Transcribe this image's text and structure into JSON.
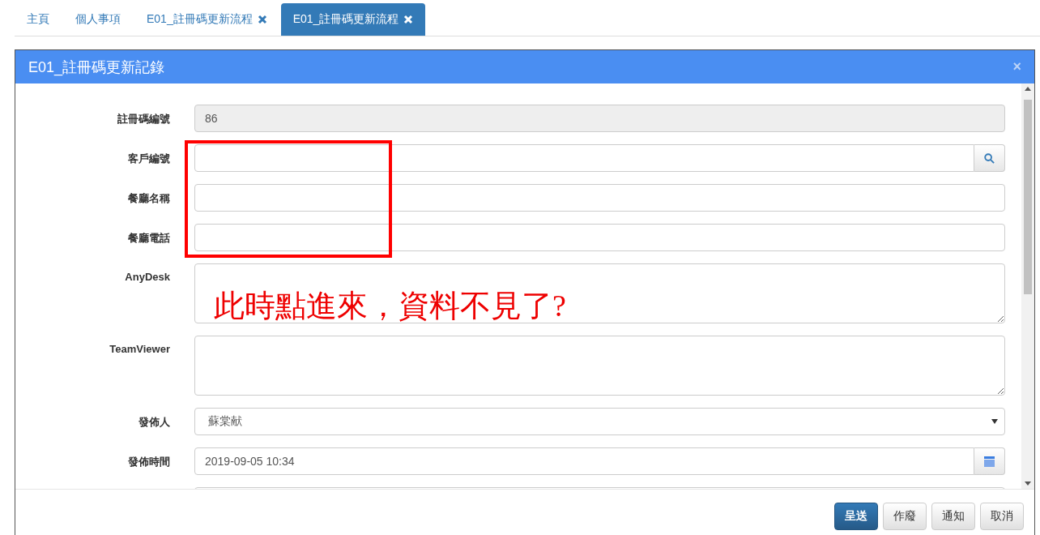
{
  "tabs": [
    {
      "label": "主頁",
      "closable": false,
      "selected": false
    },
    {
      "label": "個人事項",
      "closable": false,
      "selected": false
    },
    {
      "label": "E01_註冊碼更新流程",
      "closable": true,
      "selected": false
    },
    {
      "label": "E01_註冊碼更新流程",
      "closable": true,
      "selected": true
    }
  ],
  "dialog": {
    "title": "E01_註冊碼更新記錄",
    "close": "×",
    "fields": [
      {
        "label": "註冊碼編號",
        "kind": "readonly",
        "value": "86"
      },
      {
        "label": "客戶編號",
        "kind": "search"
      },
      {
        "label": "餐廳名稱",
        "kind": "text"
      },
      {
        "label": "餐廳電話",
        "kind": "text"
      },
      {
        "label": "AnyDesk",
        "kind": "textarea"
      },
      {
        "label": "TeamViewer",
        "kind": "textarea"
      },
      {
        "label": "發佈人",
        "kind": "select",
        "value": "蘇棠献"
      },
      {
        "label": "發佈時間",
        "kind": "date",
        "value": "2019-09-05 10:34"
      },
      {
        "kind": "text"
      }
    ],
    "buttons": [
      {
        "label": "呈送",
        "primary": true
      },
      {
        "label": "作廢",
        "primary": false
      },
      {
        "label": "通知",
        "primary": false
      },
      {
        "label": "取消",
        "primary": false
      }
    ]
  },
  "annotation": {
    "note": "此時點進來，資料不見了?"
  }
}
